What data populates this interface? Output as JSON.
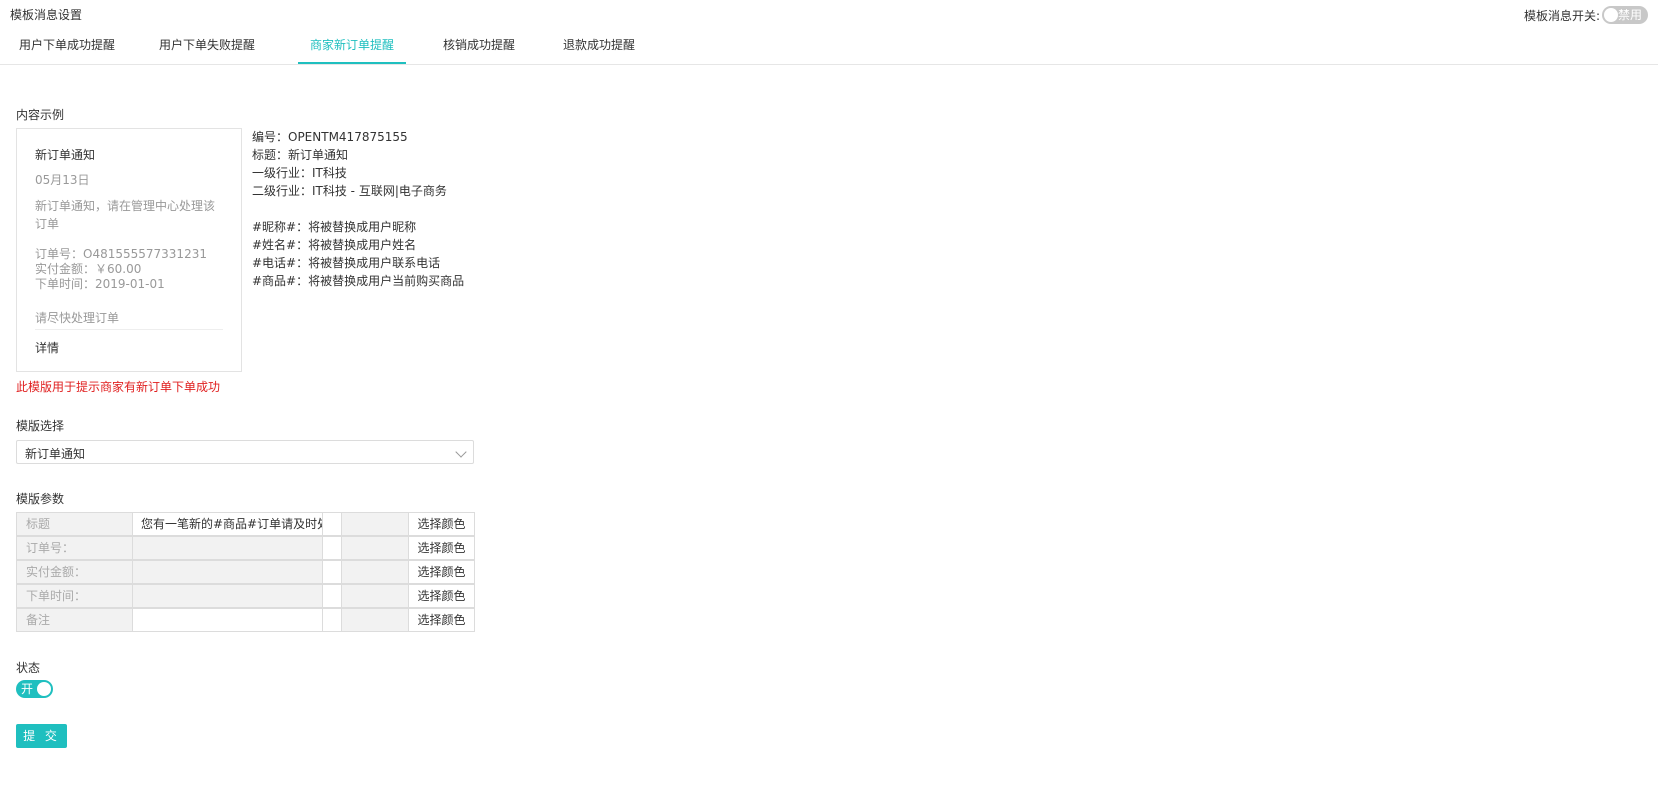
{
  "header": {
    "title": "模板消息设置",
    "switch_label": "模板消息开关:",
    "switch_state": "禁用"
  },
  "tabs": [
    {
      "label": "用户下单成功提醒",
      "active": false
    },
    {
      "label": "用户下单失败提醒",
      "active": false
    },
    {
      "label": "商家新订单提醒",
      "active": true
    },
    {
      "label": "核销成功提醒",
      "active": false
    },
    {
      "label": "退款成功提醒",
      "active": false
    }
  ],
  "example": {
    "section_label": "内容示例",
    "card": {
      "title": "新订单通知",
      "date": "05月13日",
      "intro": "新订单通知，请在管理中心处理该订单",
      "order_no": "订单号：O481555577331231",
      "amount": "实付金额：￥60.00",
      "order_time": "下单时间：2019-01-01",
      "remark": "请尽快处理订单",
      "detail": "详情"
    },
    "info": {
      "code": "编号：OPENTM417875155",
      "title": "标题：新订单通知",
      "industry1": "一级行业：IT科技",
      "industry2": "二级行业：IT科技 - 互联网|电子商务",
      "var_nickname": "#昵称#：将被替换成用户昵称",
      "var_name": "#姓名#：将被替换成用户姓名",
      "var_phone": "#电话#：将被替换成用户联系电话",
      "var_goods": "#商品#：将被替换成用户当前购买商品"
    },
    "hint": "此模版用于提示商家有新订单下单成功"
  },
  "template_select": {
    "label": "模版选择",
    "value": "新订单通知"
  },
  "params": {
    "label": "模版参数",
    "rows": [
      {
        "label": "标题",
        "value": "您有一笔新的#商品#订单请及时处理"
      },
      {
        "label": "订单号：",
        "value": ""
      },
      {
        "label": "实付金额：",
        "value": ""
      },
      {
        "label": "下单时间：",
        "value": ""
      },
      {
        "label": "备注",
        "value": ""
      }
    ],
    "pick_color_label": "选择颜色"
  },
  "status": {
    "label": "状态",
    "toggle_text": "开"
  },
  "submit_label": "提 交",
  "colors": {
    "accent": "#1fbfbf",
    "hint": "#e02020"
  }
}
